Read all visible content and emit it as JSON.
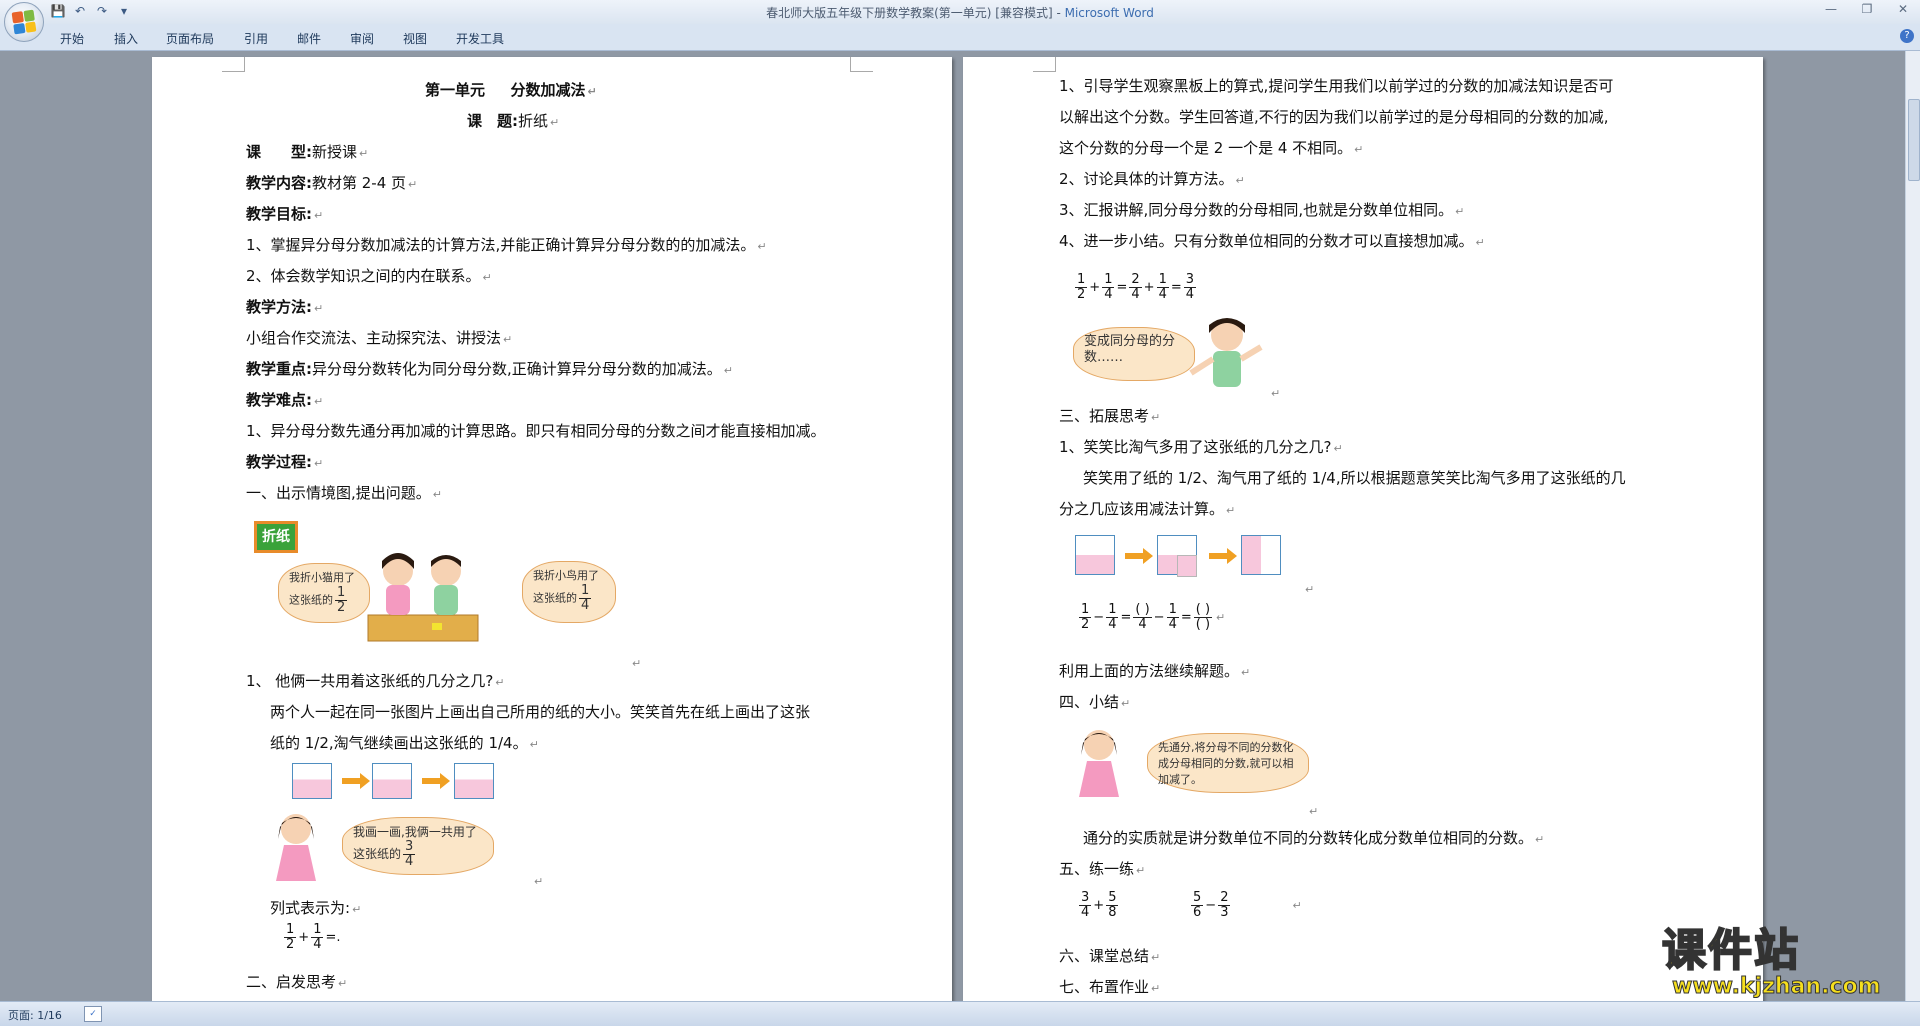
{
  "window": {
    "title": "春北师大版五年级下册数学教案(第一单元) [兼容模式]",
    "app_name": "Microsoft Word",
    "title_separator": " - "
  },
  "ribbon": {
    "tabs": [
      "开始",
      "插入",
      "页面布局",
      "引用",
      "邮件",
      "审阅",
      "视图",
      "开发工具"
    ]
  },
  "status": {
    "page": "页面: 1/16"
  },
  "left_page": {
    "title": "第一单元 　 分数加减法",
    "subtitle_label": "课　题:",
    "subtitle_value": "折纸",
    "type_label": "课　　型:",
    "type_value": "新授课",
    "content_label": "教学内容:",
    "content_value": "教材第 2-4 页",
    "goal_label": "教学目标:",
    "goal_1": "1、掌握异分母分数加减法的计算方法,并能正确计算异分母分数的的加减法。",
    "goal_2": "2、体会数学知识之间的内在联系。",
    "method_label": "教学方法:",
    "method_value": "小组合作交流法、主动探究法、讲授法",
    "key_label": "教学重点:",
    "key_value": "异分母分数转化为同分母分数,正确计算异分母分数的加减法。",
    "diff_label": "教学难点:",
    "diff_1": "1、异分母分数先通分再加减的计算思路。即只有相同分母的分数之间才能直接相加减。",
    "process_label": "教学过程:",
    "step_1": "一、出示情境图,提出问题。",
    "sign_label": "折纸",
    "bubble_left": "我折小猫用了这张纸的",
    "bubble_left_frac": [
      "1",
      "2"
    ],
    "bubble_right": "我折小鸟用了这张纸的",
    "bubble_right_frac": [
      "1",
      "4"
    ],
    "q1": "1、 他俩一共用着这张纸的几分之几?",
    "q1_p1": "两个人一起在同一张图片上画出自己所用的纸的大小。笑笑首先在纸上画出了这张",
    "q1_p2": "纸的 1/2,淘气继续画出这张纸的 1/4。",
    "bubble_mid": "我画一画,我俩一共用了这张纸的",
    "bubble_mid_frac": [
      "3",
      "4"
    ],
    "formula_label": "列式表示为:",
    "formula_frac_a": [
      "1",
      "2"
    ],
    "formula_frac_b": [
      "1",
      "4"
    ],
    "formula_plus": "+",
    "formula_eq": "=.",
    "step_2": "二、启发思考"
  },
  "right_page": {
    "p1_1": "1、引导学生观察黑板上的算式,提问学生用我们以前学过的分数的加减法知识是否可",
    "p1_2": "以解出这个分数。学生回答道,不行的因为我们以前学过的是分母相同的分数的加减,",
    "p1_3": "这个分数的分母一个是 2 一个是 4 不相同。",
    "p2": "2、讨论具体的计算方法。",
    "p3": "3、汇报讲解,同分母分数的分母相同,也就是分数单位相同。",
    "p4": "4、进一步小结。只有分数单位相同的分数才可以直接想加减。",
    "eq_top": [
      "1",
      "1",
      "2",
      "1",
      "3"
    ],
    "eq_bottom": [
      "2",
      "4",
      "4",
      "4",
      "4"
    ],
    "eq_ops": [
      "+",
      "=",
      "+",
      "="
    ],
    "bubble_boy": "变成同分母的分数……",
    "step_3": "三、拓展思考",
    "q_ext": "1、笑笑比淘气多用了这张纸的几分之几?",
    "ext_p1": "笑笑用了纸的 1/2、淘气用了纸的 1/4,所以根据题意笑笑比淘气多用了这张纸的几",
    "ext_p2": "分之几应该用减法计算。",
    "sub_top": [
      "1",
      "1",
      "( )",
      "1",
      "( )"
    ],
    "sub_bottom": [
      "2",
      "4",
      "4",
      "4",
      "( )"
    ],
    "sub_ops": [
      "−",
      "=",
      "−",
      "="
    ],
    "continue": "利用上面的方法继续解题。",
    "step_4": "四、小结",
    "bubble_girl": "先通分,将分母不同的分数化成分母相同的分数,就可以相加减了。",
    "summary": "通分的实质就是讲分数单位不同的分数转化成分数单位相同的分数。",
    "step_5": "五、练一练",
    "ex1_top": [
      "3",
      "5"
    ],
    "ex1_bottom": [
      "4",
      "8"
    ],
    "ex1_op": "+",
    "ex2_top": [
      "5",
      "2"
    ],
    "ex2_bottom": [
      "6",
      "3"
    ],
    "ex2_op": "−",
    "step_6": "六、课堂总结",
    "step_7": "七、布置作业"
  },
  "watermark": {
    "cn": "课件站",
    "url": "www.kjzhan.com"
  },
  "colors": {
    "sign_bg": "#3aa23a",
    "pink_fill": "#f7c7dc",
    "square_border": "#4f8ec0",
    "arrow": "#f0a023"
  }
}
